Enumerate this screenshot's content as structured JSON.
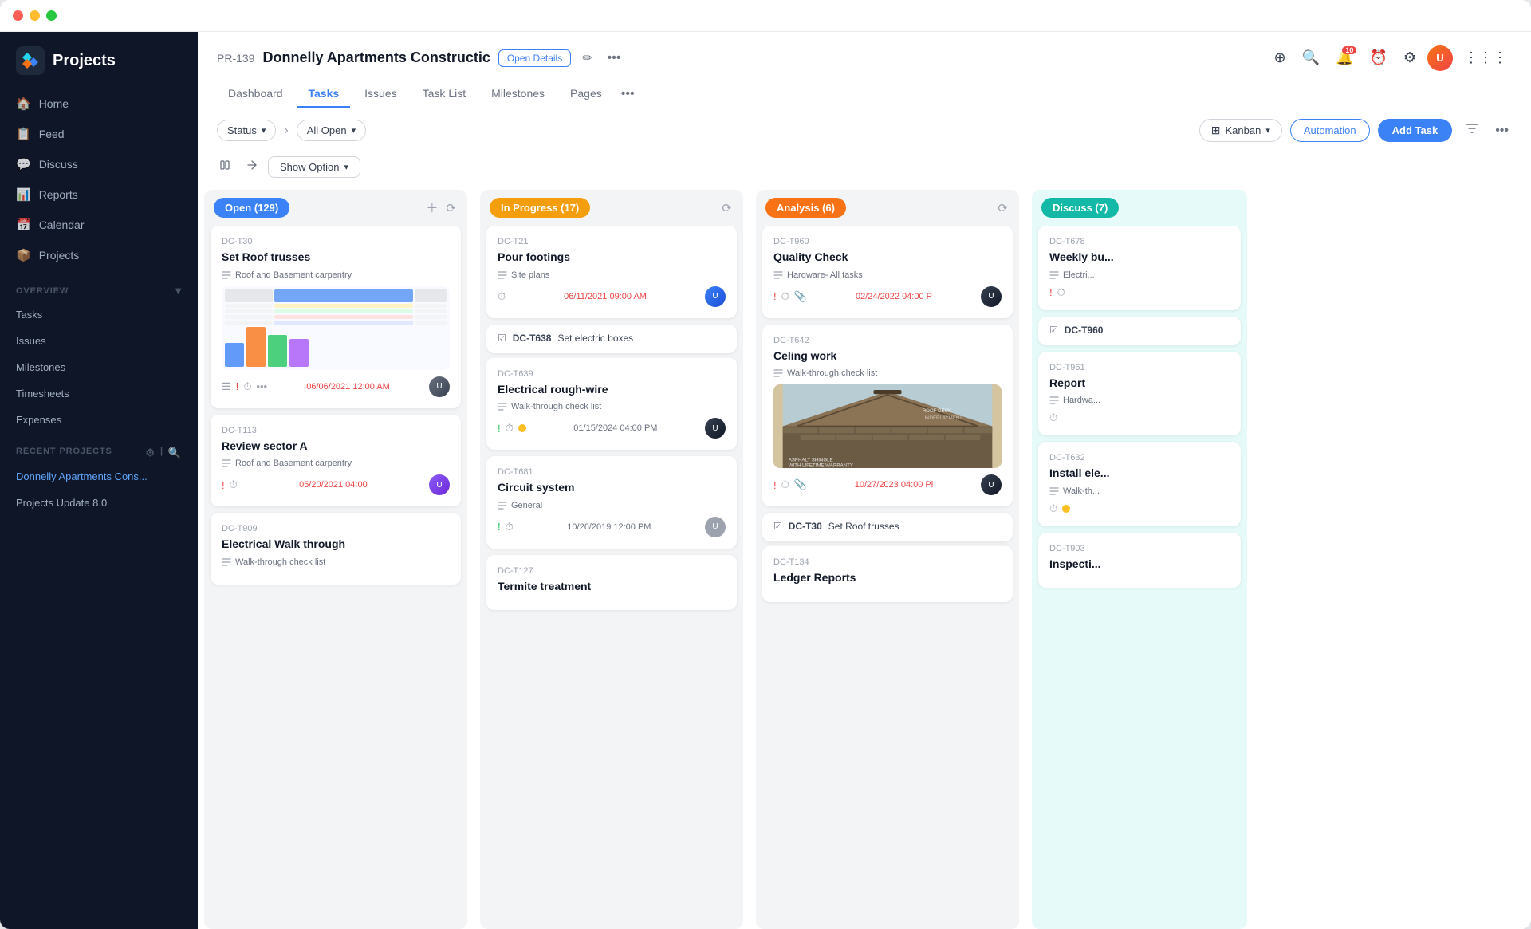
{
  "app": {
    "title": "Projects"
  },
  "titlebar": {
    "traffic_lights": [
      "red",
      "yellow",
      "green"
    ]
  },
  "sidebar": {
    "logo_text": "Projects",
    "nav_items": [
      {
        "id": "home",
        "label": "Home",
        "icon": "🏠"
      },
      {
        "id": "feed",
        "label": "Feed",
        "icon": "📋"
      },
      {
        "id": "discuss",
        "label": "Discuss",
        "icon": "💬"
      },
      {
        "id": "reports",
        "label": "Reports",
        "icon": "📊"
      },
      {
        "id": "calendar",
        "label": "Calendar",
        "icon": "📅"
      },
      {
        "id": "projects",
        "label": "Projects",
        "icon": "📦"
      }
    ],
    "overview_label": "Overview",
    "overview_items": [
      {
        "id": "tasks",
        "label": "Tasks"
      },
      {
        "id": "issues",
        "label": "Issues"
      },
      {
        "id": "milestones",
        "label": "Milestones"
      },
      {
        "id": "timesheets",
        "label": "Timesheets"
      },
      {
        "id": "expenses",
        "label": "Expenses"
      }
    ],
    "recent_label": "Recent Projects",
    "recent_items": [
      {
        "id": "donnelly",
        "label": "Donnelly Apartments Cons...",
        "active": true
      },
      {
        "id": "projects-update",
        "label": "Projects Update 8.0",
        "active": false
      }
    ]
  },
  "header": {
    "project_id": "PR-139",
    "project_name": "Donnelly Apartments Constructic",
    "open_details_label": "Open Details",
    "tabs": [
      {
        "id": "dashboard",
        "label": "Dashboard"
      },
      {
        "id": "tasks",
        "label": "Tasks",
        "active": true
      },
      {
        "id": "issues",
        "label": "Issues"
      },
      {
        "id": "task-list",
        "label": "Task List"
      },
      {
        "id": "milestones",
        "label": "Milestones"
      },
      {
        "id": "pages",
        "label": "Pages"
      }
    ],
    "notification_count": "10"
  },
  "toolbar": {
    "status_label": "Status",
    "all_open_label": "All Open",
    "kanban_label": "Kanban",
    "automation_label": "Automation",
    "add_task_label": "Add Task",
    "show_option_label": "Show Option"
  },
  "columns": [
    {
      "id": "open",
      "label": "Open (129)",
      "color_class": "col-label-open",
      "cards": [
        {
          "id": "DC-T30",
          "title": "Set Roof trusses",
          "subtitle": "Roof and Basement carpentry",
          "has_thumbnail": true,
          "thumbnail_type": "spreadsheet",
          "date": "06/06/2021 12:00 AM",
          "date_color": "red",
          "has_avatar": true,
          "avatar_color": "#6b7280"
        },
        {
          "id": "DC-T113",
          "title": "Review sector A",
          "subtitle": "Roof and Basement carpentry",
          "date": "05/20/2021 04:00",
          "date_color": "red",
          "has_avatar": true,
          "avatar_color": "#8b5cf6"
        },
        {
          "id": "DC-T909",
          "title": "Electrical Walk through",
          "subtitle": "Walk-through check list"
        }
      ]
    },
    {
      "id": "inprogress",
      "label": "In Progress (17)",
      "color_class": "col-label-inprogress",
      "cards": [
        {
          "id": "DC-T21",
          "title": "Pour footings",
          "subtitle": "Site plans",
          "date": "06/11/2021 09:00 AM",
          "date_color": "red",
          "has_avatar": true,
          "avatar_color": "#3b82f6"
        },
        {
          "id": "DC-T638",
          "group_task": "Set electric boxes",
          "sub_id": "DC-T639",
          "title": "Electrical rough-wire",
          "subtitle": "Walk-through check list",
          "date": "01/15/2024 04:00 PM",
          "date_color": "gray",
          "has_avatar": true,
          "avatar_color": "#374151",
          "has_dot": "yellow"
        },
        {
          "id": "DC-T681",
          "title": "Circuit system",
          "subtitle": "General",
          "date": "10/26/2019 12:00 PM",
          "date_color": "gray",
          "has_avatar": true,
          "avatar_color": "#9ca3af"
        },
        {
          "id": "DC-T127",
          "title": "Termite treatment",
          "subtitle": ""
        }
      ]
    },
    {
      "id": "analysis",
      "label": "Analysis (6)",
      "color_class": "col-label-analysis",
      "cards": [
        {
          "id": "DC-T960",
          "title": "Quality Check",
          "subtitle": "Hardware- All tasks",
          "date": "02/24/2022 04:00 P",
          "date_color": "red",
          "has_avatar": true,
          "avatar_color": "#374151"
        },
        {
          "id": "DC-T642",
          "title": "Celing work",
          "subtitle": "Walk-through check list",
          "has_thumbnail": true,
          "thumbnail_type": "roof",
          "date": "10/27/2023 04:00 Pl",
          "date_color": "red",
          "has_avatar": true,
          "avatar_color": "#374151"
        },
        {
          "group_task": "Set Roof trusses",
          "id": "DC-T30",
          "sub_id": "DC-T134",
          "title": "Ledger Reports",
          "subtitle": ""
        }
      ]
    },
    {
      "id": "discuss",
      "label": "Discuss (7)",
      "color_class": "col-label-discuss",
      "partial": true,
      "cards": [
        {
          "id": "DC-T678",
          "title": "Weekly bu...",
          "subtitle": "Electri..."
        },
        {
          "id": "DC-T960",
          "sub_id": "DC-T961",
          "title": "Report",
          "subtitle": "Hardwa..."
        },
        {
          "id": "DC-T632",
          "title": "Install ele...",
          "subtitle": "Walk-th..."
        },
        {
          "id": "DC-T903",
          "title": "Inspecti...",
          "subtitle": ""
        }
      ]
    }
  ]
}
